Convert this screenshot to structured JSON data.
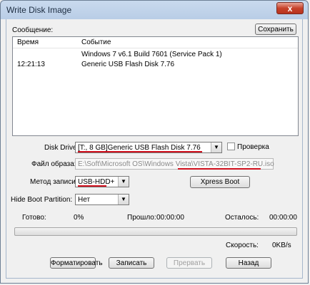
{
  "window": {
    "title": "Write Disk Image",
    "close_glyph": "x"
  },
  "log": {
    "label": "Сообщение:",
    "save_button": "Сохранить",
    "col_time": "Время",
    "col_event": "Событие",
    "rows": [
      {
        "time": "",
        "event": "Windows 7 v6.1 Build 7601 (Service Pack 1)"
      },
      {
        "time": "12:21:13",
        "event": "Generic USB Flash Disk  7.76"
      }
    ]
  },
  "disk_drive": {
    "label": "Disk Drive:",
    "value": "[T:, 8 GB]Generic USB Flash Disk  7.76",
    "check_label": "Проверка",
    "checked": false
  },
  "image_file": {
    "label": "Файл образа:",
    "value": "E:\\Soft\\Microsoft OS\\Windows Vista\\VISTA-32BIT-SP2-RU.iso"
  },
  "write_method": {
    "label": "Метод записи:",
    "value": "USB-HDD+",
    "xpress_button": "Xpress Boot"
  },
  "hide_boot": {
    "label": "Hide Boot Partition:",
    "value": "Нет"
  },
  "status": {
    "done_label": "Готово:",
    "done_value": "0%",
    "elapsed_label": "Прошло:",
    "elapsed_value": "00:00:00",
    "remaining_label": "Осталось:",
    "remaining_value": "00:00:00",
    "speed_label": "Скорость:",
    "speed_value": "0KB/s",
    "progress": 0
  },
  "buttons": {
    "format": "Форматировать",
    "write": "Записать",
    "abort": "Прервать",
    "back": "Назад"
  },
  "colors": {
    "highlight_underline": "#d0101e",
    "title_bar": "#c9daee"
  },
  "icons": {
    "close": "close-icon",
    "dropdown": "chevron-down-icon"
  }
}
